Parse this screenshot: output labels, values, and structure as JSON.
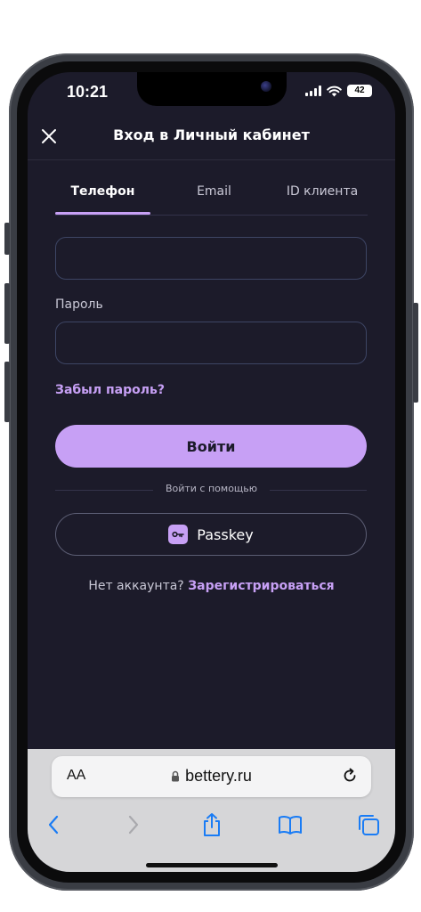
{
  "status_bar": {
    "time": "10:21",
    "battery": "42"
  },
  "header": {
    "title": "Вход в Личный кабинет"
  },
  "tabs": [
    {
      "label": "Телефон",
      "active": true
    },
    {
      "label": "Email",
      "active": false
    },
    {
      "label": "ID клиента",
      "active": false
    }
  ],
  "form": {
    "phone_value": "",
    "password_label": "Пароль",
    "password_value": "",
    "forgot_link": "Забыл пароль?",
    "login_button": "Войти",
    "divider_text": "Войти с помощью",
    "passkey_button": "Passkey"
  },
  "register": {
    "prompt": "Нет аккаунта?",
    "link": "Зарегистрироваться"
  },
  "browser": {
    "aa_label": "AA",
    "url": "bettery.ru"
  },
  "colors": {
    "accent": "#c7a0f5",
    "background": "#1c1b2a",
    "field_border": "#3d4564"
  },
  "icons": [
    "close-icon",
    "signal-icon",
    "wifi-icon",
    "battery-icon",
    "key-icon",
    "lock-icon",
    "reload-icon",
    "back-icon",
    "forward-icon",
    "share-icon",
    "bookmarks-icon",
    "tabs-icon"
  ]
}
